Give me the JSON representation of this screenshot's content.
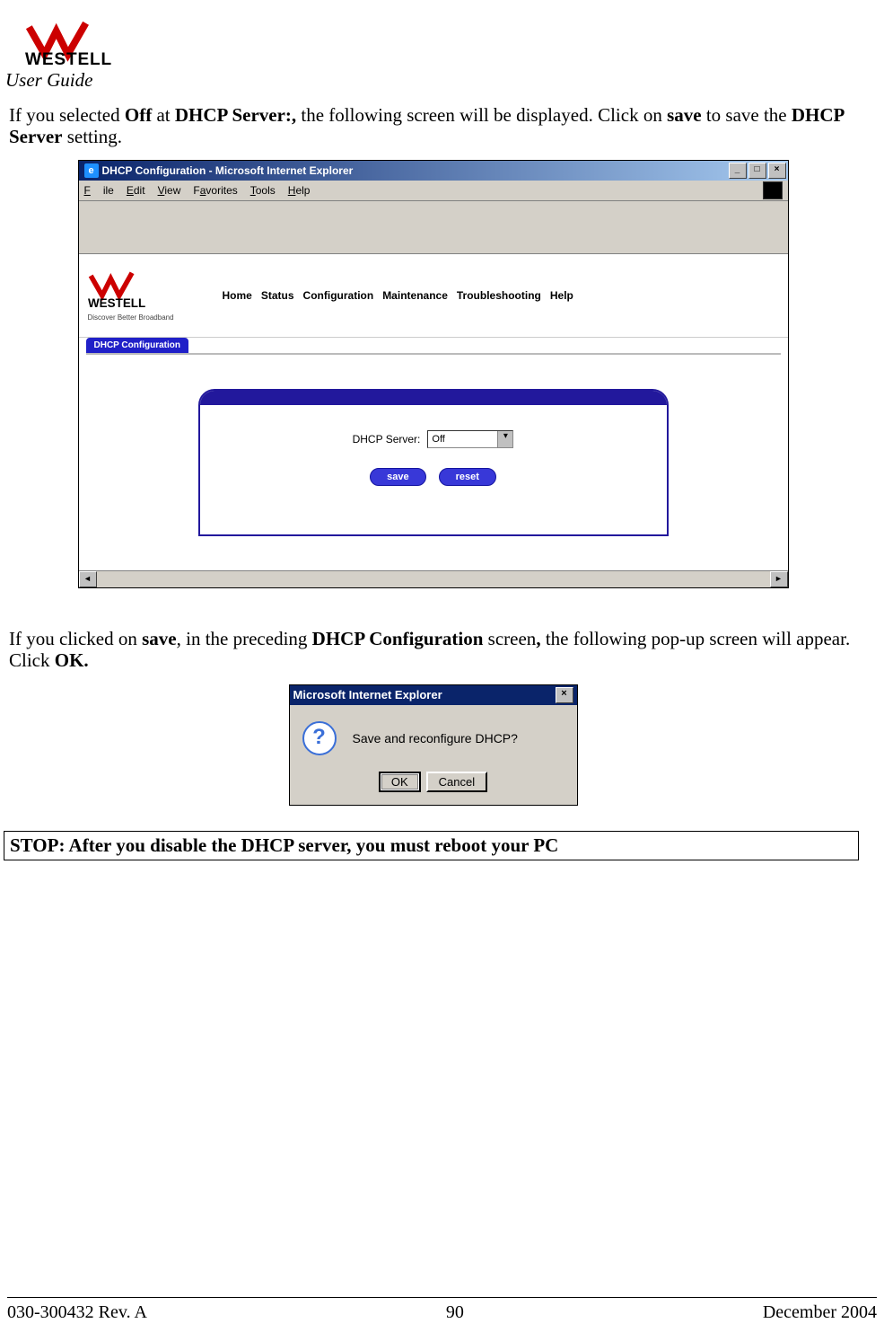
{
  "header": {
    "brand": "WESTELL",
    "subtitle": "User Guide"
  },
  "para1": {
    "t1": "If you selected ",
    "b1": "Off",
    "t2": " at ",
    "b2": "DHCP Server:,",
    "t3": " the following screen will be displayed. Click on ",
    "b3": "save",
    "t4": " to save the ",
    "b4": "DHCP Server",
    "t5": " setting."
  },
  "browser": {
    "title": "DHCP Configuration - Microsoft Internet Explorer",
    "menu": {
      "file": "File",
      "edit": "Edit",
      "view": "View",
      "favorites": "Favorites",
      "tools": "Tools",
      "help": "Help"
    },
    "logo_tagline": "Discover Better Broadband",
    "nav": [
      "Home",
      "Status",
      "Configuration",
      "Maintenance",
      "Troubleshooting",
      "Help"
    ],
    "tab": "DHCP Configuration",
    "field_label": "DHCP Server:",
    "field_value": "Off",
    "btn_save": "save",
    "btn_reset": "reset"
  },
  "para2": {
    "t1": "If you clicked on ",
    "b1": "save",
    "t2": ", in the preceding ",
    "b2": "DHCP Configuration",
    "t3": " screen",
    "b3": ",",
    "t4": " the following pop-up screen will appear. Click ",
    "b4": "OK."
  },
  "dialog": {
    "title": "Microsoft Internet Explorer",
    "message": "Save and reconfigure DHCP?",
    "ok": "OK",
    "cancel": "Cancel"
  },
  "stop": "STOP: After you disable the DHCP server, you must reboot your PC",
  "footer": {
    "left": "030-300432 Rev. A",
    "center": "90",
    "right": "December 2004"
  }
}
